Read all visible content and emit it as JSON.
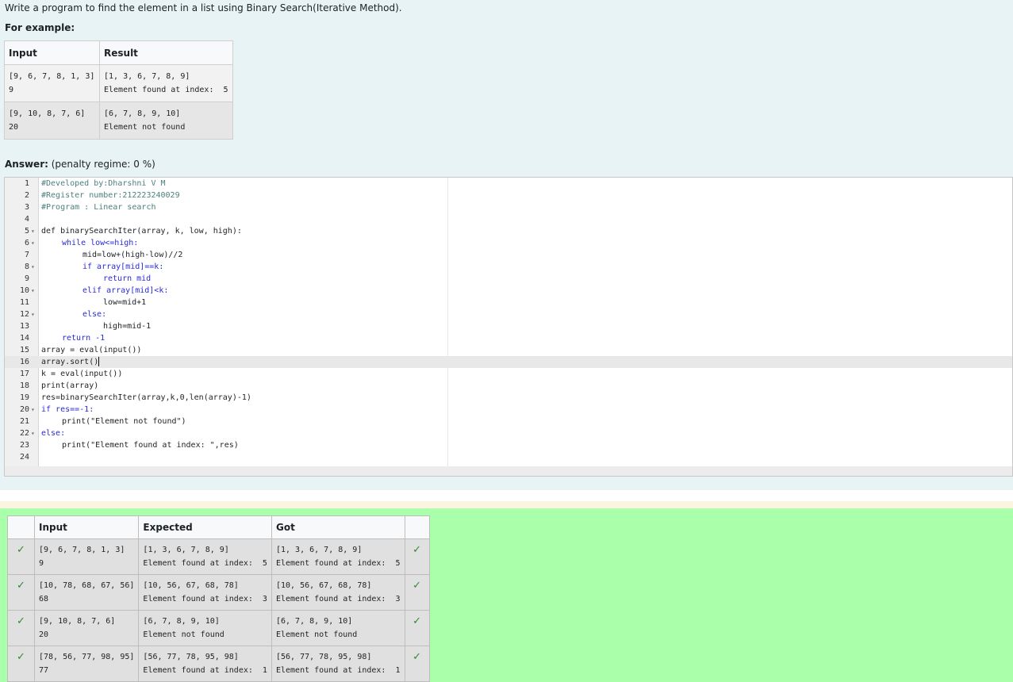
{
  "question": {
    "text": "Write a program to find the element in a list using Binary Search(Iterative Method).",
    "example_label": "For example:",
    "example_table": {
      "headers": [
        "Input",
        "Result"
      ],
      "rows": [
        {
          "input": [
            "[9, 6, 7, 8, 1, 3]",
            "9"
          ],
          "result": [
            "[1, 3, 6, 7, 8, 9]",
            "Element found at index:  5"
          ]
        },
        {
          "input": [
            "[9, 10, 8, 7, 6]",
            "20"
          ],
          "result": [
            "[6, 7, 8, 9, 10]",
            "Element not found"
          ]
        }
      ]
    }
  },
  "answer": {
    "label": "Answer:",
    "penalty": "(penalty regime: 0 %)"
  },
  "editor": {
    "active_line": 16,
    "lines": [
      {
        "n": "1",
        "fold": "",
        "indent": 0,
        "text": "#Developed by:Dharshni V M",
        "kind": "com"
      },
      {
        "n": "2",
        "fold": "",
        "indent": 0,
        "text": "#Register number:212223240029",
        "kind": "com"
      },
      {
        "n": "3",
        "fold": "",
        "indent": 0,
        "text": "#Program : Linear search",
        "kind": "com"
      },
      {
        "n": "4",
        "fold": "",
        "indent": 0,
        "text": "",
        "kind": "plain"
      },
      {
        "n": "5",
        "fold": "▾",
        "indent": 0,
        "text": "def binarySearchIter(array, k, low, high):",
        "kind": "def"
      },
      {
        "n": "6",
        "fold": "▾",
        "indent": 1,
        "text": "while low<=high:",
        "kind": "kw"
      },
      {
        "n": "7",
        "fold": "",
        "indent": 2,
        "text": "mid=low+(high-low)//2",
        "kind": "plain"
      },
      {
        "n": "8",
        "fold": "▾",
        "indent": 2,
        "text": "if array[mid]==k:",
        "kind": "kw"
      },
      {
        "n": "9",
        "fold": "",
        "indent": 3,
        "text": "return mid",
        "kind": "kw"
      },
      {
        "n": "10",
        "fold": "▾",
        "indent": 2,
        "text": "elif array[mid]<k:",
        "kind": "kw"
      },
      {
        "n": "11",
        "fold": "",
        "indent": 3,
        "text": "low=mid+1",
        "kind": "plain"
      },
      {
        "n": "12",
        "fold": "▾",
        "indent": 2,
        "text": "else:",
        "kind": "kw"
      },
      {
        "n": "13",
        "fold": "",
        "indent": 3,
        "text": "high=mid-1",
        "kind": "plain"
      },
      {
        "n": "14",
        "fold": "",
        "indent": 1,
        "text": "return -1",
        "kind": "kw"
      },
      {
        "n": "15",
        "fold": "",
        "indent": 0,
        "text": "array = eval(input())",
        "kind": "plain"
      },
      {
        "n": "16",
        "fold": "",
        "indent": 0,
        "text": "array.sort()",
        "kind": "plain"
      },
      {
        "n": "17",
        "fold": "",
        "indent": 0,
        "text": "k = eval(input())",
        "kind": "plain"
      },
      {
        "n": "18",
        "fold": "",
        "indent": 0,
        "text": "print(array)",
        "kind": "plain"
      },
      {
        "n": "19",
        "fold": "",
        "indent": 0,
        "text": "res=binarySearchIter(array,k,0,len(array)-1)",
        "kind": "plain"
      },
      {
        "n": "20",
        "fold": "▾",
        "indent": 0,
        "text": "if res==-1:",
        "kind": "kw"
      },
      {
        "n": "21",
        "fold": "",
        "indent": 1,
        "text": "print(\"Element not found\")",
        "kind": "plain"
      },
      {
        "n": "22",
        "fold": "▾",
        "indent": 0,
        "text": "else:",
        "kind": "kw"
      },
      {
        "n": "23",
        "fold": "",
        "indent": 1,
        "text": "print(\"Element found at index: \",res)",
        "kind": "plain"
      },
      {
        "n": "24",
        "fold": "",
        "indent": 0,
        "text": "",
        "kind": "plain"
      }
    ]
  },
  "results": {
    "headers": [
      "",
      "Input",
      "Expected",
      "Got",
      ""
    ],
    "rows": [
      {
        "input": [
          "[9, 6, 7, 8, 1, 3]",
          "9"
        ],
        "expected": [
          "[1, 3, 6, 7, 8, 9]",
          "Element found at index:  5"
        ],
        "got": [
          "[1, 3, 6, 7, 8, 9]",
          "Element found at index:  5"
        ]
      },
      {
        "input": [
          "[10, 78, 68, 67, 56]",
          "68"
        ],
        "expected": [
          "[10, 56, 67, 68, 78]",
          "Element found at index:  3"
        ],
        "got": [
          "[10, 56, 67, 68, 78]",
          "Element found at index:  3"
        ]
      },
      {
        "input": [
          "[9, 10, 8, 7, 6]",
          "20"
        ],
        "expected": [
          "[6, 7, 8, 9, 10]",
          "Element not found"
        ],
        "got": [
          "[6, 7, 8, 9, 10]",
          "Element not found"
        ]
      },
      {
        "input": [
          "[78, 56, 77, 98, 95]",
          "77"
        ],
        "expected": [
          "[56, 77, 78, 95, 98]",
          "Element found at index:  1"
        ],
        "got": [
          "[56, 77, 78, 95, 98]",
          "Element found at index:  1"
        ]
      }
    ],
    "pass_icon": "check-icon",
    "pass_color": "#2e8b2e",
    "panel_color": "#aaffaa"
  }
}
